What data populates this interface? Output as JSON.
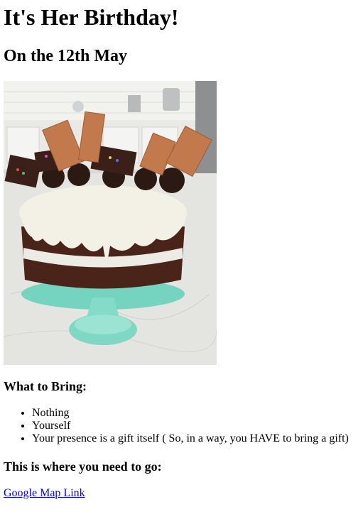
{
  "page": {
    "title": "It's Her Birthday!",
    "date_heading": "On the 12th May"
  },
  "image": {
    "subject": "cake-photo"
  },
  "bring": {
    "heading": "What to Bring:",
    "items": [
      "Nothing",
      "Yourself",
      "Your presence is a gift itself ( So, in a way, you HAVE to bring a gift)"
    ]
  },
  "location": {
    "heading": "This is where you need to go:",
    "link_text": "Google Map Link"
  },
  "colors": {
    "link": "#0000ee",
    "stand": "#7fd8c4",
    "cake": "#4a2418",
    "frosting": "#f3f1e6"
  }
}
